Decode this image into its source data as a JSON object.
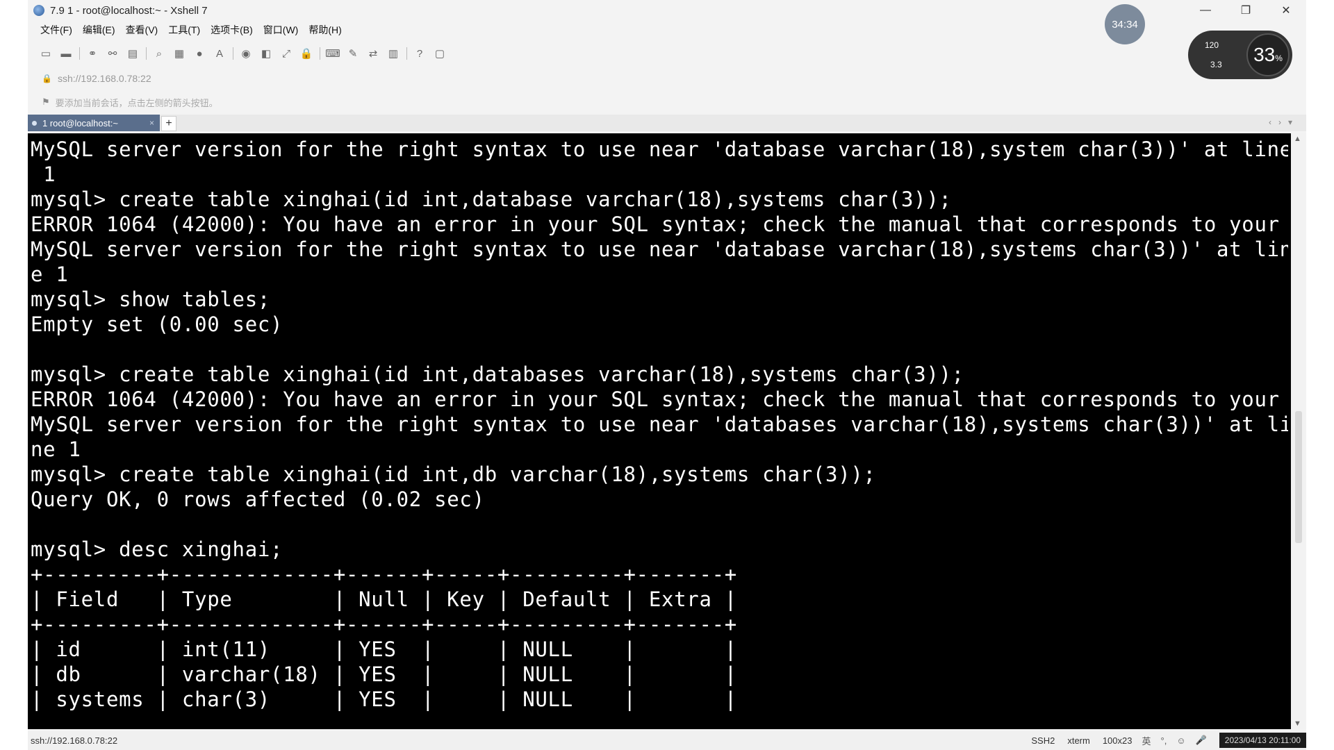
{
  "window": {
    "title": "7.9 1 - root@localhost:~ - Xshell 7",
    "controls": {
      "minimize": "—",
      "restore": "❐",
      "close": "✕"
    }
  },
  "menu": [
    "文件(F)",
    "编辑(E)",
    "查看(V)",
    "工具(T)",
    "选项卡(B)",
    "窗口(W)",
    "帮助(H)"
  ],
  "address": {
    "value": "ssh://192.168.0.78:22"
  },
  "hint": {
    "text": "要添加当前会话，点击左侧的箭头按钮。"
  },
  "tab": {
    "label": "1 root@localhost:~",
    "close": "×",
    "add": "+"
  },
  "terminal": {
    "lines": [
      "MySQL server version for the right syntax to use near 'database varchar(18),system char(3))' at line",
      " 1",
      "mysql> create table xinghai(id int,database varchar(18),systems char(3));",
      "ERROR 1064 (42000): You have an error in your SQL syntax; check the manual that corresponds to your",
      "MySQL server version for the right syntax to use near 'database varchar(18),systems char(3))' at lin",
      "e 1",
      "mysql> show tables;",
      "Empty set (0.00 sec)",
      "",
      "mysql> create table xinghai(id int,databases varchar(18),systems char(3));",
      "ERROR 1064 (42000): You have an error in your SQL syntax; check the manual that corresponds to your",
      "MySQL server version for the right syntax to use near 'databases varchar(18),systems char(3))' at li",
      "ne 1",
      "mysql> create table xinghai(id int,db varchar(18),systems char(3));",
      "Query OK, 0 rows affected (0.02 sec)",
      "",
      "mysql> desc xinghai;",
      "+---------+-------------+------+-----+---------+-------+",
      "| Field   | Type        | Null | Key | Default | Extra |",
      "+---------+-------------+------+-----+---------+-------+",
      "| id      | int(11)     | YES  |     | NULL    |       |",
      "| db      | varchar(18) | YES  |     | NULL    |       |",
      "| systems | char(3)     | YES  |     | NULL    |       |"
    ]
  },
  "status": {
    "session": "ssh://192.168.0.78:22",
    "protocol": "SSH2",
    "term": "xterm",
    "size": "100x23",
    "ime": [
      "英",
      "°,",
      "☺",
      "🎤"
    ],
    "clock": "2023/04/13 20:11:00"
  },
  "overlay": {
    "timer": "34:34",
    "net_up": "120",
    "net_down": "3.3",
    "cpu": "33",
    "cpu_unit": "%"
  },
  "colors": {
    "terminal_bg": "#000000",
    "terminal_fg": "#ffffff",
    "tab_active": "#5a6e8c"
  }
}
